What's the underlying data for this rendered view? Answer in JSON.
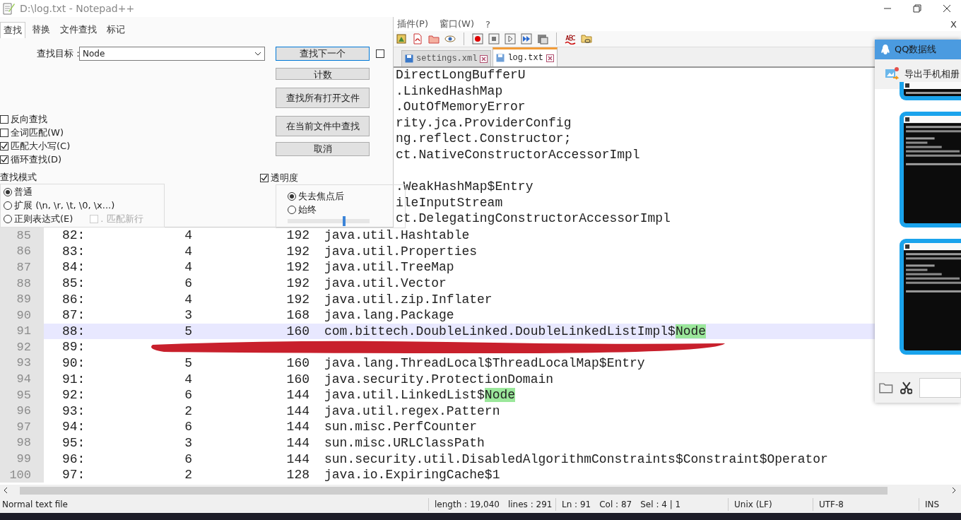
{
  "window": {
    "title": "D:\\log.txt - Notepad++"
  },
  "menu": [
    "插件(P)",
    "窗口(W)",
    "?"
  ],
  "close_document": "X",
  "tabs": [
    {
      "label": "settings.xml",
      "selected": false
    },
    {
      "label": "log.txt",
      "selected": true
    }
  ],
  "editor": {
    "rows": [
      {
        "kind": "covered",
        "tail": "DirectLongBufferU"
      },
      {
        "kind": "covered",
        "tail": ".LinkedHashMap"
      },
      {
        "kind": "covered",
        "tail": ".OutOfMemoryError"
      },
      {
        "kind": "covered",
        "tail": "rity.jca.ProviderConfig"
      },
      {
        "kind": "covered",
        "tail": "ng.reflect.Constructor;"
      },
      {
        "kind": "covered",
        "tail": "ct.NativeConstructorAccessorImpl"
      },
      {
        "kind": "covered"
      },
      {
        "kind": "covered",
        "tail": ".WeakHashMap$Entry"
      },
      {
        "kind": "covered",
        "tail": "ileInputStream"
      },
      {
        "kind": "covered",
        "tail": "ct.DelegatingConstructorAccessorImpl"
      },
      {
        "kind": "text",
        "line": "85",
        "index": "82:",
        "count": "4",
        "bytes": "192",
        "class": "java.util.Hashtable",
        "current": false
      },
      {
        "kind": "text",
        "line": "86",
        "index": "83:",
        "count": "4",
        "bytes": "192",
        "class": "java.util.Properties",
        "current": false
      },
      {
        "kind": "text",
        "line": "87",
        "index": "84:",
        "count": "4",
        "bytes": "192",
        "class": "java.util.TreeMap",
        "current": false
      },
      {
        "kind": "text",
        "line": "88",
        "index": "85:",
        "count": "6",
        "bytes": "192",
        "class": "java.util.Vector",
        "current": false
      },
      {
        "kind": "text",
        "line": "89",
        "index": "86:",
        "count": "4",
        "bytes": "192",
        "class": "java.util.zip.Inflater",
        "current": false
      },
      {
        "kind": "text",
        "line": "90",
        "index": "87:",
        "count": "3",
        "bytes": "168",
        "class": "java.lang.Package",
        "current": false
      },
      {
        "kind": "text",
        "line": "91",
        "index": "88:",
        "count": "5",
        "bytes": "160",
        "class": "com.bittech.DoubleLinked.DoubleLinkedListImpl$",
        "match": "Node",
        "current": true
      },
      {
        "kind": "redacted",
        "line": "92",
        "index": "89:"
      },
      {
        "kind": "text",
        "line": "93",
        "index": "90:",
        "count": "5",
        "bytes": "160",
        "class": "java.lang.ThreadLocal$ThreadLocalMap$Entry",
        "current": false
      },
      {
        "kind": "text",
        "line": "94",
        "index": "91:",
        "count": "4",
        "bytes": "160",
        "class": "java.security.ProtectionDomain",
        "current": false
      },
      {
        "kind": "text",
        "line": "95",
        "index": "92:",
        "count": "6",
        "bytes": "144",
        "class": "java.util.LinkedList$",
        "match": "Node",
        "current": false
      },
      {
        "kind": "text",
        "line": "96",
        "index": "93:",
        "count": "2",
        "bytes": "144",
        "class": "java.util.regex.Pattern",
        "current": false
      },
      {
        "kind": "text",
        "line": "97",
        "index": "94:",
        "count": "6",
        "bytes": "144",
        "class": "sun.misc.PerfCounter",
        "current": false
      },
      {
        "kind": "text",
        "line": "98",
        "index": "95:",
        "count": "3",
        "bytes": "144",
        "class": "sun.misc.URLClassPath",
        "current": false
      },
      {
        "kind": "text",
        "line": "99",
        "index": "96:",
        "count": "6",
        "bytes": "144",
        "class": "sun.security.util.DisabledAlgorithmConstraints$Constraint$Operator",
        "current": false
      },
      {
        "kind": "text",
        "line": "100",
        "index": "97:",
        "count": "2",
        "bytes": "128",
        "class": "java.io.ExpiringCache$1",
        "current": false
      }
    ]
  },
  "find_dialog": {
    "tabs": [
      {
        "label": "查找",
        "selected": true
      },
      {
        "label": "替换",
        "selected": false
      },
      {
        "label": "文件查找",
        "selected": false
      },
      {
        "label": "标记",
        "selected": false
      }
    ],
    "target_label": "查找目标：",
    "target_value": "Node",
    "buttons": [
      "查找下一个",
      "计数",
      "查找所有打开文件",
      "在当前文件中查找",
      "取消"
    ],
    "extra_checkbox": {
      "checked": false
    },
    "options": [
      {
        "label": "反向查找",
        "checked": false
      },
      {
        "label": "全词匹配(W)",
        "checked": false
      },
      {
        "label": "匹配大小写(C)",
        "checked": true
      },
      {
        "label": "循环查找(D)",
        "checked": true
      }
    ],
    "mode": {
      "title": "查找模式",
      "options": [
        {
          "label": "普通",
          "selected": true
        },
        {
          "label": "扩展 (\\n, \\r, \\t, \\0, \\x...)",
          "selected": false
        },
        {
          "label": "正则表达式(E)",
          "selected": false
        }
      ]
    },
    "match_newline": {
      "label": ". 匹配新行",
      "checked": false,
      "disabled": true
    },
    "transparency": {
      "label": "透明度",
      "checked": true,
      "options": [
        {
          "label": "失去焦点后",
          "selected": true
        },
        {
          "label": "始终",
          "selected": false
        }
      ],
      "level": 0.7
    }
  },
  "qq_panel": {
    "title": "QQ数据线",
    "action": "导出手机相册"
  },
  "status_bar": {
    "file_type": "Normal text file",
    "length": "length : 19,040",
    "lines": "lines : 291",
    "position": "Ln : 91",
    "column": "Col : 87",
    "selection": "Sel : 4 | 1",
    "eol": "Unix (LF)",
    "encoding": "UTF-8",
    "mode": "INS"
  }
}
